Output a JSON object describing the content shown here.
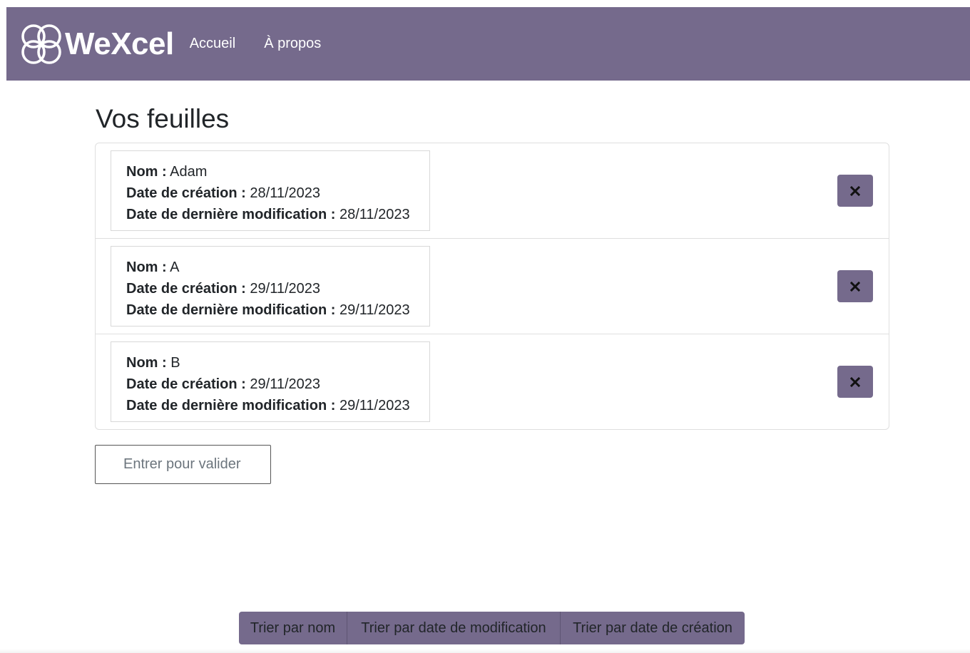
{
  "brand": {
    "name": "WeXcel",
    "logo_icon": "four-circles-logo-icon"
  },
  "nav": {
    "items": [
      {
        "label": "Accueil"
      },
      {
        "label": "À propos"
      }
    ]
  },
  "main": {
    "title": "Vos feuilles"
  },
  "labels": {
    "name": "Nom :",
    "created": "Date de création :",
    "modified": "Date de dernière modification :"
  },
  "sheets": [
    {
      "name": "Adam",
      "created": "28/11/2023",
      "modified": "28/11/2023",
      "delete_icon": "close-icon"
    },
    {
      "name": "A",
      "created": "29/11/2023",
      "modified": "29/11/2023",
      "delete_icon": "close-icon"
    },
    {
      "name": "B",
      "created": "29/11/2023",
      "modified": "29/11/2023",
      "delete_icon": "close-icon"
    }
  ],
  "input": {
    "placeholder": "Entrer pour valider",
    "value": ""
  },
  "sort": {
    "by_name": "Trier par nom",
    "by_modified": "Trier par date de modification",
    "by_created": "Trier par date de création"
  },
  "colors": {
    "accent": "#756a8c",
    "border": "#dfdfdf",
    "text": "#212529"
  }
}
